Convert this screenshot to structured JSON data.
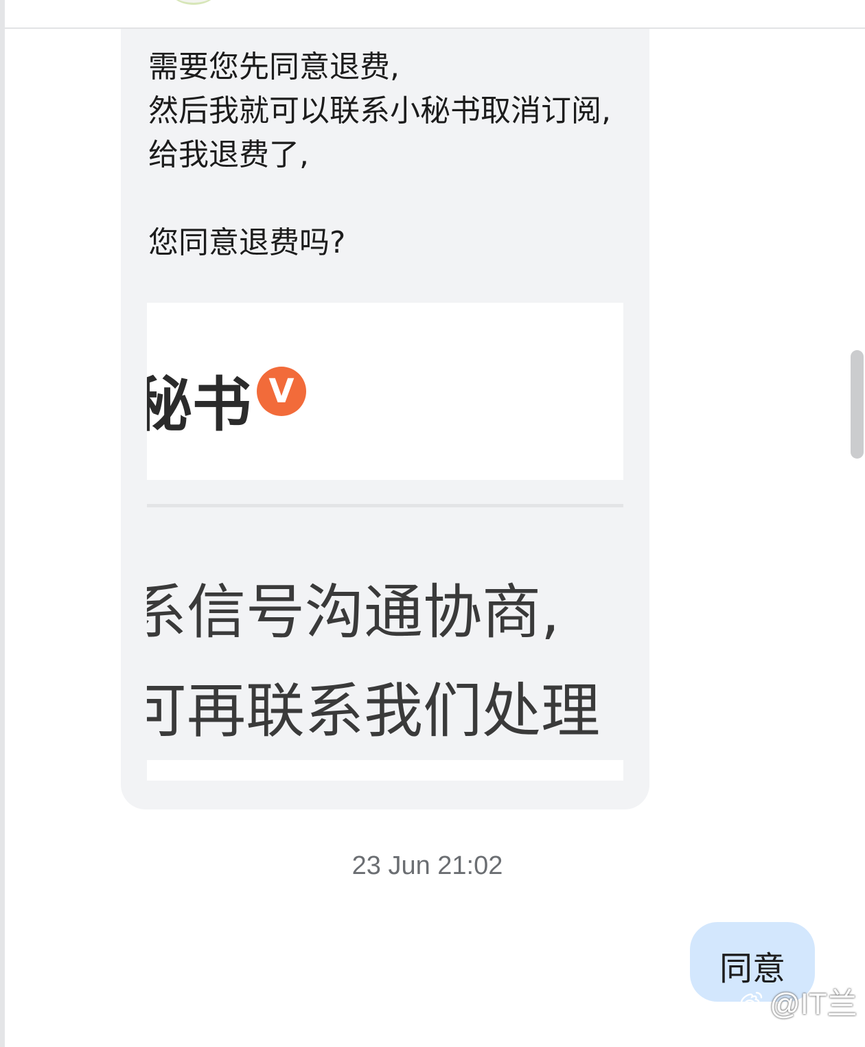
{
  "conversation": {
    "incoming_message": {
      "text": "需要您先同意退费,\n然后我就可以联系小秘书取消订阅,给我退费了,\n\n您同意退费吗?",
      "attachment": {
        "account_name": "秘书",
        "verified_badge": "V",
        "lines": [
          "系信号沟通协商,",
          "可再联系我们处理"
        ]
      }
    },
    "timestamp": "23 Jun 21:02",
    "outgoing_message": {
      "text": "同意"
    }
  },
  "watermark": {
    "text": "@IT兰",
    "icon": "weibo-logo-icon"
  },
  "colors": {
    "incoming_bubble": "#f2f3f5",
    "outgoing_bubble": "#d3e7fd",
    "verified_badge": "#f26b3a"
  }
}
